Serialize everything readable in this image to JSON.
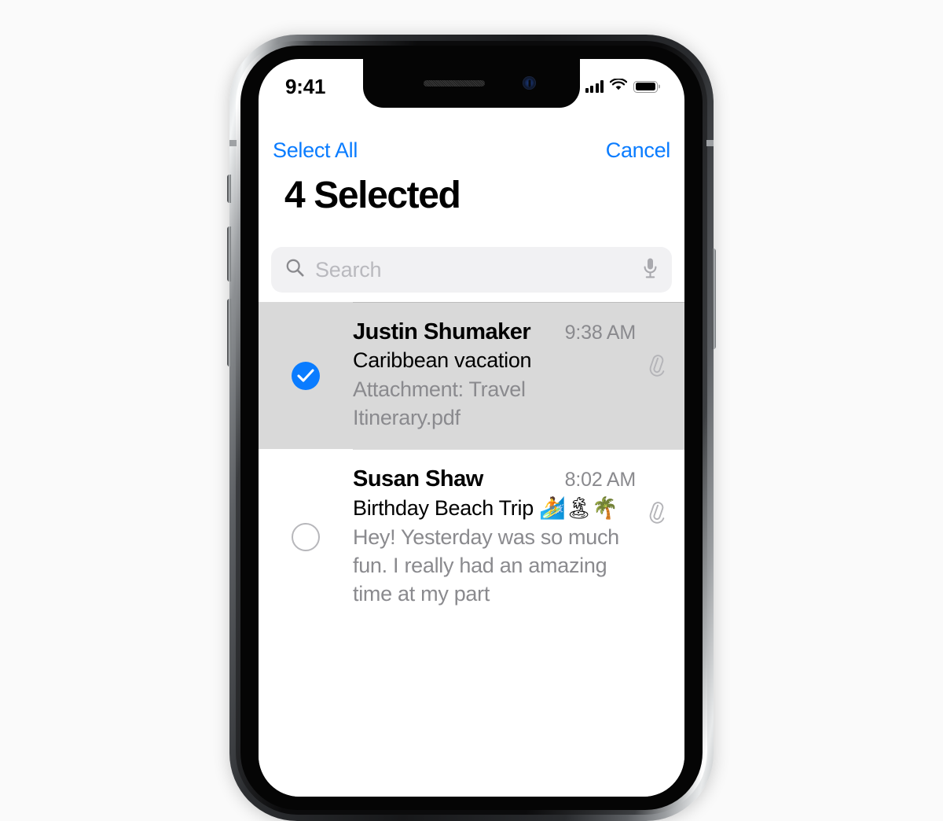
{
  "background_color": "#fafafa",
  "accent_color": "#0a7cff",
  "device": {
    "name": "iPhone",
    "notch": {
      "earpiece": "earpiece-speaker",
      "camera": "front-camera"
    },
    "buttons": [
      {
        "name": "silent-switch"
      },
      {
        "name": "volume-up-button"
      },
      {
        "name": "volume-down-button"
      },
      {
        "name": "power-button"
      }
    ]
  },
  "status_bar": {
    "time": "9:41",
    "cellular_icon": "cellular-signal-icon",
    "cellular_bars": 4,
    "wifi_icon": "wifi-icon",
    "battery_icon": "battery-icon",
    "battery_level": 100
  },
  "nav_bar": {
    "left_label": "Select All",
    "right_label": "Cancel"
  },
  "title": "4 Selected",
  "selected_count": 4,
  "search": {
    "placeholder": "Search",
    "value": "",
    "search_icon": "search-icon",
    "mic_icon": "microphone-icon",
    "background_color": "#f1f1f3"
  },
  "mail_list": {
    "selected_row_color": "#d9d9d9",
    "rows": [
      {
        "sender": "Justin Shumaker",
        "time": "9:38 AM",
        "subject": "Caribbean vacation",
        "preview": "Attachment: Travel Itinerary.pdf",
        "selected": true,
        "has_attachment": true,
        "checkbox_icon": "checkmark-circle-filled-icon",
        "attachment_icon": "paperclip-icon"
      },
      {
        "sender": "Susan Shaw",
        "time": "8:02 AM",
        "subject": "Birthday Beach Trip 🏄🏝🌴",
        "preview": "Hey! Yesterday was so much fun. I really had an amazing time at my part",
        "selected": false,
        "has_attachment": true,
        "checkbox_icon": "circle-outline-icon",
        "attachment_icon": "paperclip-icon"
      }
    ]
  }
}
